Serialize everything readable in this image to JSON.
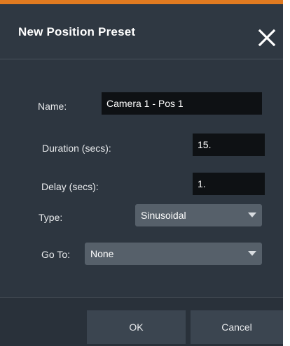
{
  "dialog": {
    "title": "New Position Preset",
    "close_icon": "close-icon",
    "accent_color": "#e07a20"
  },
  "form": {
    "name_label": "Name:",
    "name_value": "Camera 1 - Pos 1",
    "duration_label": "Duration (secs):",
    "duration_value": "15.",
    "delay_label": "Delay (secs):",
    "delay_value": "1.",
    "type_label": "Type:",
    "type_value": "Sinusoidal",
    "goto_label": "Go To:",
    "goto_value": "None"
  },
  "footer": {
    "ok_label": "OK",
    "cancel_label": "Cancel"
  }
}
